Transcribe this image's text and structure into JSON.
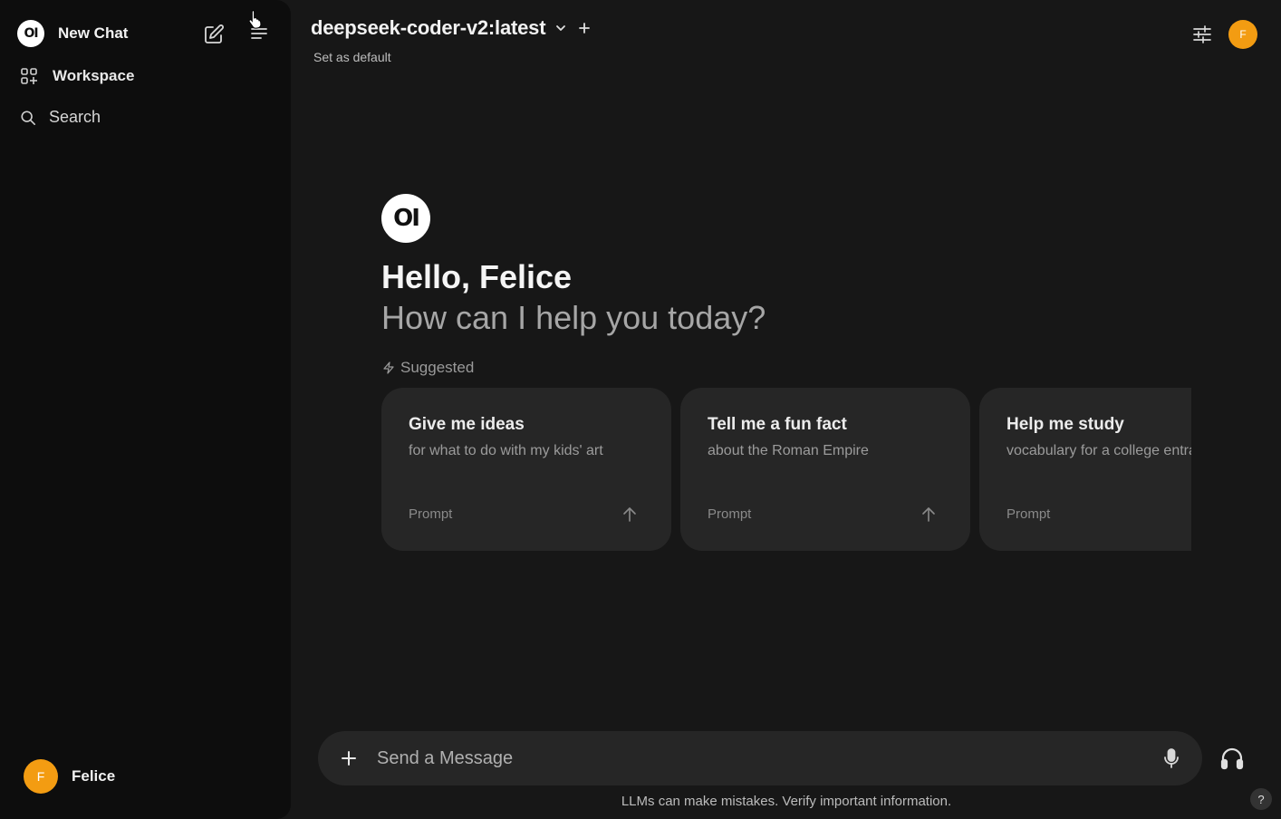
{
  "sidebar": {
    "logo_text": "OI",
    "new_chat_label": "New Chat",
    "workspace_label": "Workspace",
    "search_label": "Search",
    "user": {
      "initial": "F",
      "name": "Felice"
    }
  },
  "header": {
    "model_name": "deepseek-coder-v2:latest",
    "set_default_label": "Set as default",
    "avatar_initial": "F"
  },
  "welcome": {
    "logo_text": "OI",
    "greeting": "Hello, Felice",
    "subtitle": "How can I help you today?",
    "suggested_label": "Suggested"
  },
  "suggestions": [
    {
      "title": "Give me ideas",
      "subtitle": "for what to do with my kids' art",
      "kind": "Prompt"
    },
    {
      "title": "Tell me a fun fact",
      "subtitle": "about the Roman Empire",
      "kind": "Prompt"
    },
    {
      "title": "Help me study",
      "subtitle": "vocabulary for a college entrance exam",
      "kind": "Prompt"
    }
  ],
  "composer": {
    "placeholder": "Send a Message",
    "disclaimer": "LLMs can make mistakes. Verify important information.",
    "help_label": "?"
  },
  "colors": {
    "sidebar_bg": "#0d0d0d",
    "main_bg": "#171717",
    "card_bg": "#262626",
    "avatar": "#f39c12"
  }
}
